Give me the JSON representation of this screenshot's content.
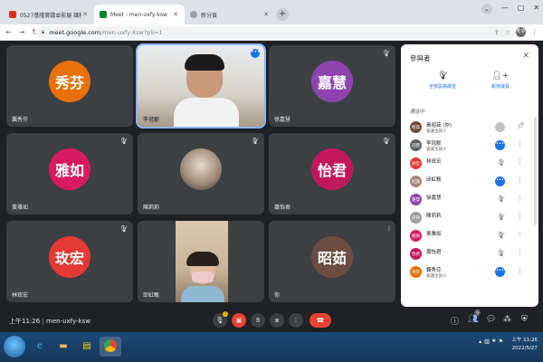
{
  "browser": {
    "tabs": [
      {
        "label": "0527基隆實踐並影展 議程 - ext",
        "fav_color": "#d93025",
        "active": false
      },
      {
        "label": "Meet - men-uxfy-ksw",
        "fav_color": "#00832d",
        "active": true
      },
      {
        "label": "新分頁",
        "fav_color": "#9aa0a6",
        "active": false
      }
    ],
    "address_host": "meet.google.com",
    "address_path": "/men-uxfy-ksw?pli=1",
    "profile_label": "秀芬"
  },
  "tiles": [
    {
      "name": "龔秀芬",
      "initials": "秀芬",
      "color": "#e8710a",
      "type": "avatar",
      "muted": false
    },
    {
      "name": "李冠郡",
      "initials": "",
      "color": "",
      "type": "video",
      "muted": false
    },
    {
      "name": "徐嘉慧",
      "initials": "嘉慧",
      "color": "#8e44ad",
      "type": "avatar",
      "muted": true
    },
    {
      "name": "黃雅如",
      "initials": "雅如",
      "color": "#d81b60",
      "type": "avatar",
      "muted": true
    },
    {
      "name": "陳莉莉",
      "initials": "",
      "color": "",
      "type": "circle",
      "muted": true
    },
    {
      "name": "蕭怡君",
      "initials": "怡君",
      "color": "#c2185b",
      "type": "avatar",
      "muted": true
    },
    {
      "name": "林玫宏",
      "initials": "玫宏",
      "color": "#e53935",
      "type": "avatar",
      "muted": true
    },
    {
      "name": "邱虹甄",
      "initials": "",
      "color": "",
      "type": "portrait",
      "muted": false
    },
    {
      "name": "你",
      "initials": "昭茹",
      "color": "#6d4c41",
      "type": "avatar",
      "muted": false
    }
  ],
  "panel": {
    "title": "參與者",
    "action_mute_all": "全部設為靜音",
    "action_add": "新增成員",
    "section_label": "通話中",
    "participants": [
      {
        "name": "黃昭茹 (你)",
        "role": "會議主辦人",
        "initials": "昭茹",
        "color": "#6d4c41",
        "status": "gray"
      },
      {
        "name": "李冠郡",
        "role": "會議主辦人",
        "initials": "冠郡",
        "color": "#5f6368",
        "status": "dot"
      },
      {
        "name": "林玫宏",
        "role": "",
        "initials": "玫宏",
        "color": "#e53935",
        "status": "mic"
      },
      {
        "name": "邱虹甄",
        "role": "",
        "initials": "虹甄",
        "color": "#a1887f",
        "status": "dot"
      },
      {
        "name": "徐嘉慧",
        "role": "",
        "initials": "嘉慧",
        "color": "#8e44ad",
        "status": "mic"
      },
      {
        "name": "陳莉莉",
        "role": "",
        "initials": "莉莉",
        "color": "#9e9e9e",
        "status": "mic"
      },
      {
        "name": "黃雅如",
        "role": "",
        "initials": "雅如",
        "color": "#d81b60",
        "status": "mic"
      },
      {
        "name": "蕭怡君",
        "role": "",
        "initials": "怡君",
        "color": "#c2185b",
        "status": "mic"
      },
      {
        "name": "龔秀芬",
        "role": "會議主辦人",
        "initials": "秀芬",
        "color": "#e8710a",
        "status": "dot"
      }
    ]
  },
  "bottom": {
    "time": "上午11:26",
    "meeting_code": "men-uxfy-ksw",
    "participants_count": "9",
    "raise_badge": "1"
  },
  "taskbar": {
    "clock_time": "上午 11:26",
    "clock_date": "2022/5/27"
  }
}
